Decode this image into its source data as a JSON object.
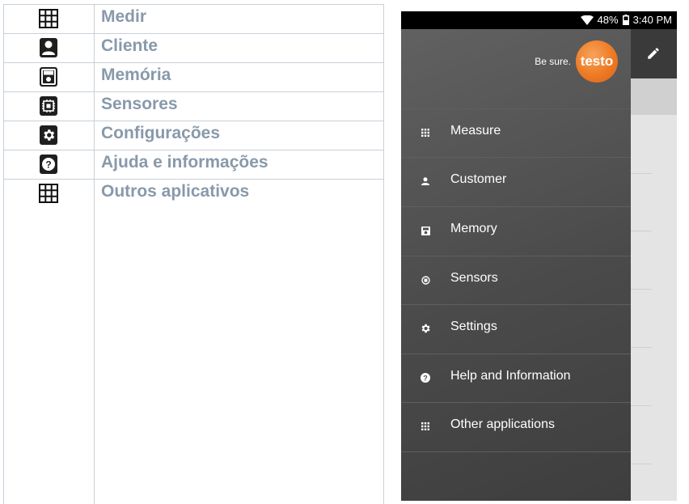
{
  "doc_table": {
    "rows": [
      {
        "icon": "grid-icon",
        "label": "Medir"
      },
      {
        "icon": "person-icon",
        "label": "Cliente"
      },
      {
        "icon": "save-icon",
        "label": "Memória"
      },
      {
        "icon": "chip-icon",
        "label": "Sensores"
      },
      {
        "icon": "gear-icon",
        "label": "Configurações"
      },
      {
        "icon": "help-icon",
        "label": "Ajuda e informações"
      },
      {
        "icon": "grid-icon",
        "label": "Outros aplicativos"
      }
    ]
  },
  "phone": {
    "status": {
      "battery": "48%",
      "time": "3:40 PM"
    },
    "brand": {
      "tagline": "Be sure.",
      "logo": "testo"
    },
    "menu": [
      {
        "icon": "grid-icon",
        "label": "Measure"
      },
      {
        "icon": "person-icon",
        "label": "Customer"
      },
      {
        "icon": "save-icon",
        "label": "Memory"
      },
      {
        "icon": "chip-icon",
        "label": "Sensors"
      },
      {
        "icon": "gear-icon",
        "label": "Settings"
      },
      {
        "icon": "help-icon",
        "label": "Help and Information"
      },
      {
        "icon": "grid-icon",
        "label": "Other applications"
      }
    ],
    "edit_icon": "pencil-icon",
    "colors": {
      "logo": "#ee7a23",
      "drawer": "#4e4e4e",
      "label_text": "#8899aa"
    }
  }
}
